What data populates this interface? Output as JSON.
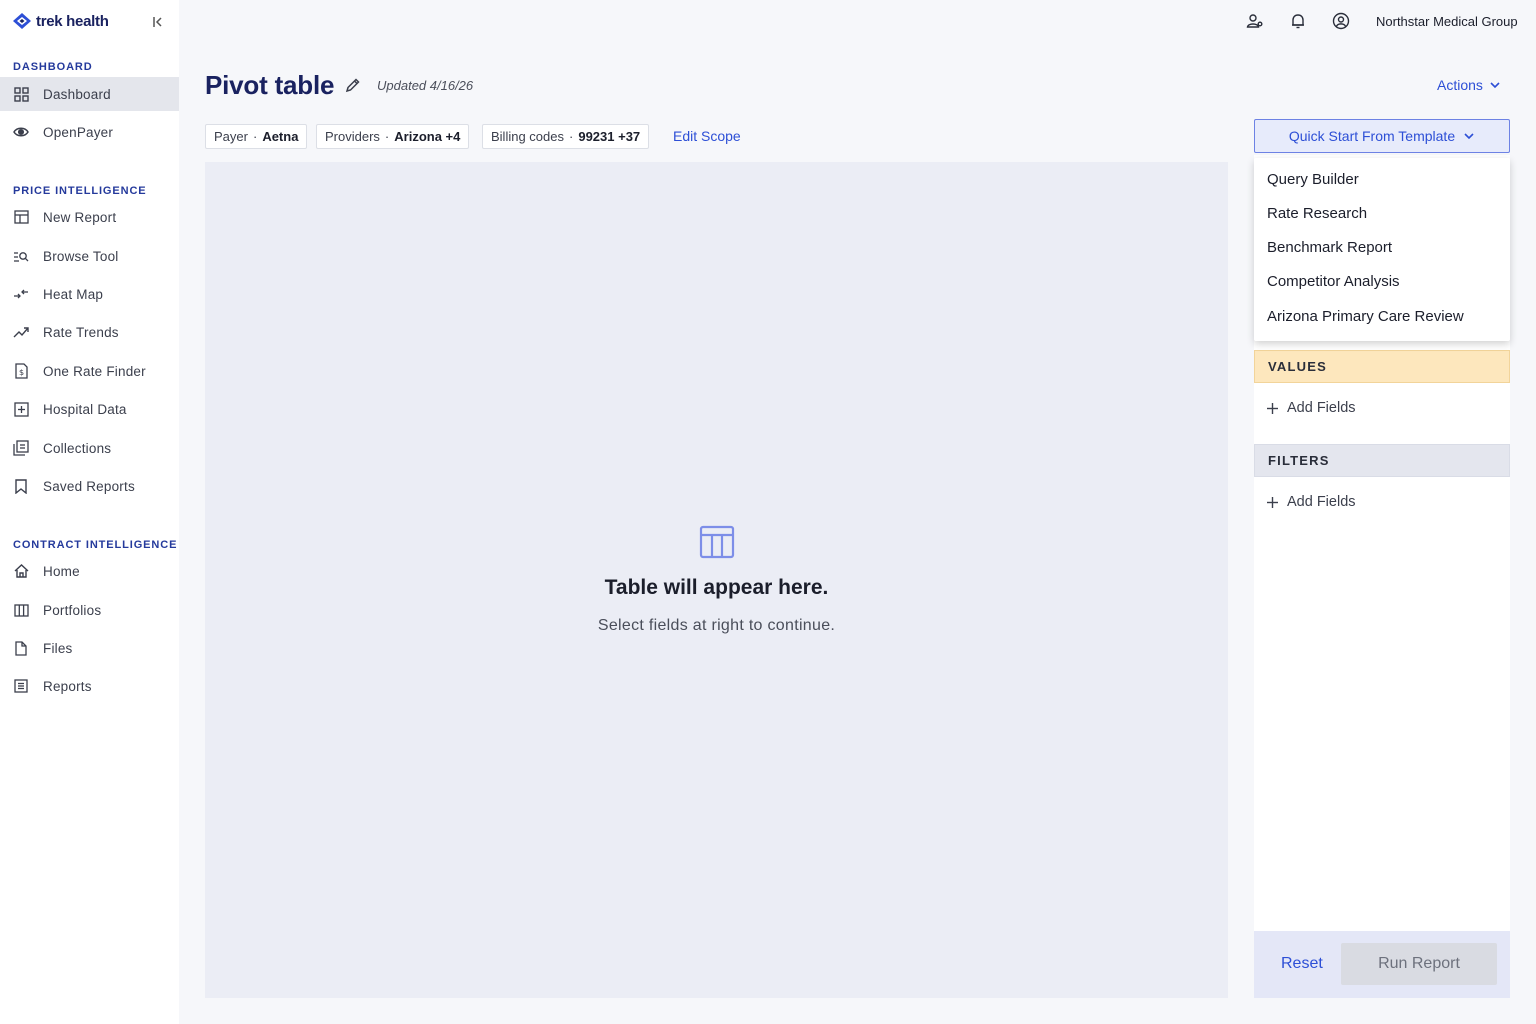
{
  "app": {
    "logo_text": "trek health",
    "org_name": "Northstar Medical Group"
  },
  "sidebar": {
    "sections": [
      {
        "label": "DASHBOARD",
        "items": [
          {
            "label": "Dashboard",
            "icon": "grid-icon"
          },
          {
            "label": "OpenPayer",
            "icon": "eye-icon"
          }
        ]
      },
      {
        "label": "PRICE INTELLIGENCE",
        "items": [
          {
            "label": "New Report",
            "icon": "table-icon"
          },
          {
            "label": "Browse Tool",
            "icon": "browse-icon"
          },
          {
            "label": "Heat Map",
            "icon": "arrows-icon"
          },
          {
            "label": "Rate Trends",
            "icon": "trend-icon"
          },
          {
            "label": "One Rate Finder",
            "icon": "document-dollar-icon"
          },
          {
            "label": "Hospital Data",
            "icon": "hospital-icon"
          },
          {
            "label": "Collections",
            "icon": "collections-icon"
          },
          {
            "label": "Saved Reports",
            "icon": "bookmark-icon"
          }
        ]
      },
      {
        "label": "CONTRACT INTELLIGENCE",
        "items": [
          {
            "label": "Home",
            "icon": "home-icon"
          },
          {
            "label": "Portfolios",
            "icon": "columns-icon"
          },
          {
            "label": "Files",
            "icon": "file-icon"
          },
          {
            "label": "Reports",
            "icon": "report-icon"
          }
        ]
      }
    ]
  },
  "header": {
    "title": "Pivot table",
    "updated": "Updated 4/16/26",
    "actions_label": "Actions"
  },
  "scope": {
    "chips": [
      {
        "label": "Payer",
        "value": "Aetna"
      },
      {
        "label": "Providers",
        "value": "Arizona +4"
      },
      {
        "label": "Billing codes",
        "value": "99231 +37"
      }
    ],
    "edit_label": "Edit Scope",
    "separator": "·"
  },
  "canvas": {
    "empty_title": "Table will appear here.",
    "empty_subtitle": "Select fields at right to continue."
  },
  "panel": {
    "template_button": "Quick Start From Template",
    "template_options": [
      "Query Builder",
      "Rate Research",
      "Benchmark Report",
      "Competitor Analysis",
      "Arizona Primary Care Review"
    ],
    "values_header": "VALUES",
    "filters_header": "FILTERS",
    "add_fields_label": "Add Fields",
    "reset_label": "Reset",
    "run_label": "Run Report"
  },
  "colors": {
    "brand": "#1a2260",
    "accent": "#2d4fd6",
    "values_bg": "#fde7bd",
    "canvas_bg": "#ebedf5"
  }
}
